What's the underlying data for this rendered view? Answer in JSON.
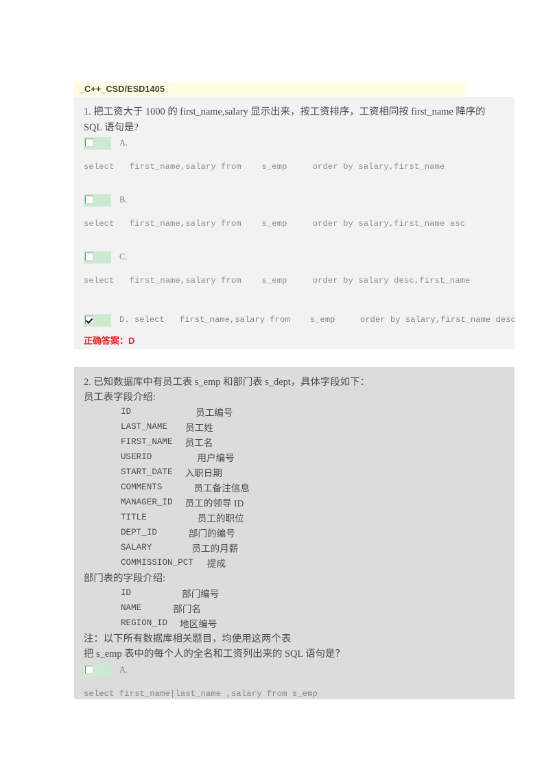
{
  "document": {
    "title": "_C++_CSD/ESD1405"
  },
  "questions": [
    {
      "number": "1.",
      "stem_lines": [
        "1.  把工资大于 1000 的 first_name,salary  显示出来，按工资排序，工资相同按 first_name 降序的",
        "SQL 语句是?"
      ],
      "options": [
        {
          "letter": "A.",
          "checked": false,
          "inline": false,
          "sql": "select   first_name,salary from    s_emp     order by salary,first_name"
        },
        {
          "letter": "B.",
          "checked": false,
          "inline": false,
          "sql": "select   first_name,salary from    s_emp     order by salary,first_name asc"
        },
        {
          "letter": "C.",
          "checked": false,
          "inline": false,
          "sql": "select   first_name,salary from    s_emp     order by salary desc,first_name"
        },
        {
          "letter": "D.",
          "checked": true,
          "inline": true,
          "sql": "D. select   first_name,salary from    s_emp     order by salary,first_name desc"
        }
      ],
      "answer_label": "正确答案：D"
    },
    {
      "number": "2.",
      "stem_lines": [
        "2.  已知数据库中有员工表 s_emp 和部门表 s_dept，具体字段如下：",
        "员工表字段介绍:"
      ],
      "emp_fields": [
        {
          "name": "ID",
          "desc": "员工编号",
          "desc_indent": 128
        },
        {
          "name": "LAST_NAME",
          "desc": "员工姓",
          "desc_indent": 88
        },
        {
          "name": "FIRST_NAME",
          "desc": "员工名",
          "desc_indent": 88
        },
        {
          "name": "USERID",
          "desc": "用户编号",
          "desc_indent": 108
        },
        {
          "name": "START_DATE",
          "desc": "入职日期",
          "desc_indent": 88
        },
        {
          "name": "COMMENTS",
          "desc": "员工备注信息",
          "desc_indent": 108
        },
        {
          "name": "MANAGER_ID",
          "desc": "员工的领导 ID",
          "desc_indent": 88
        },
        {
          "name": "TITLE",
          "desc": "员工的职位",
          "desc_indent": 108
        },
        {
          "name": "DEPT_ID",
          "desc": "部门的编号",
          "desc_indent": 98
        },
        {
          "name": "SALARY",
          "desc": "员工的月薪",
          "desc_indent": 108
        },
        {
          "name": "COMMISSION_PCT",
          "desc": "提成",
          "desc_indent": 128
        }
      ],
      "dept_header": "部门表的字段介绍:",
      "dept_fields": [
        {
          "name": "ID",
          "desc": "部门编号",
          "desc_indent": 128
        },
        {
          "name": "NAME",
          "desc": "部门名",
          "desc_indent": 98
        },
        {
          "name": "REGION_ID",
          "desc": "地区编号",
          "desc_indent": 78
        }
      ],
      "note": "注：以下所有数据库相关题目，均使用这两个表",
      "sub_question": "把 s_emp 表中的每个人的全名和工资列出来的 SQL 语句是？",
      "options": [
        {
          "letter": "A.",
          "checked": false,
          "inline": false,
          "sql": "select first_name|last_name ,salary from s_emp"
        }
      ]
    }
  ],
  "colors": {
    "title_bg": "#fdfbe0",
    "q1_bg": "#f2f2f2",
    "q2_bg": "#dcdcdc",
    "checkbox_bg": "#cdead0",
    "answer_red": "#e4262c"
  }
}
